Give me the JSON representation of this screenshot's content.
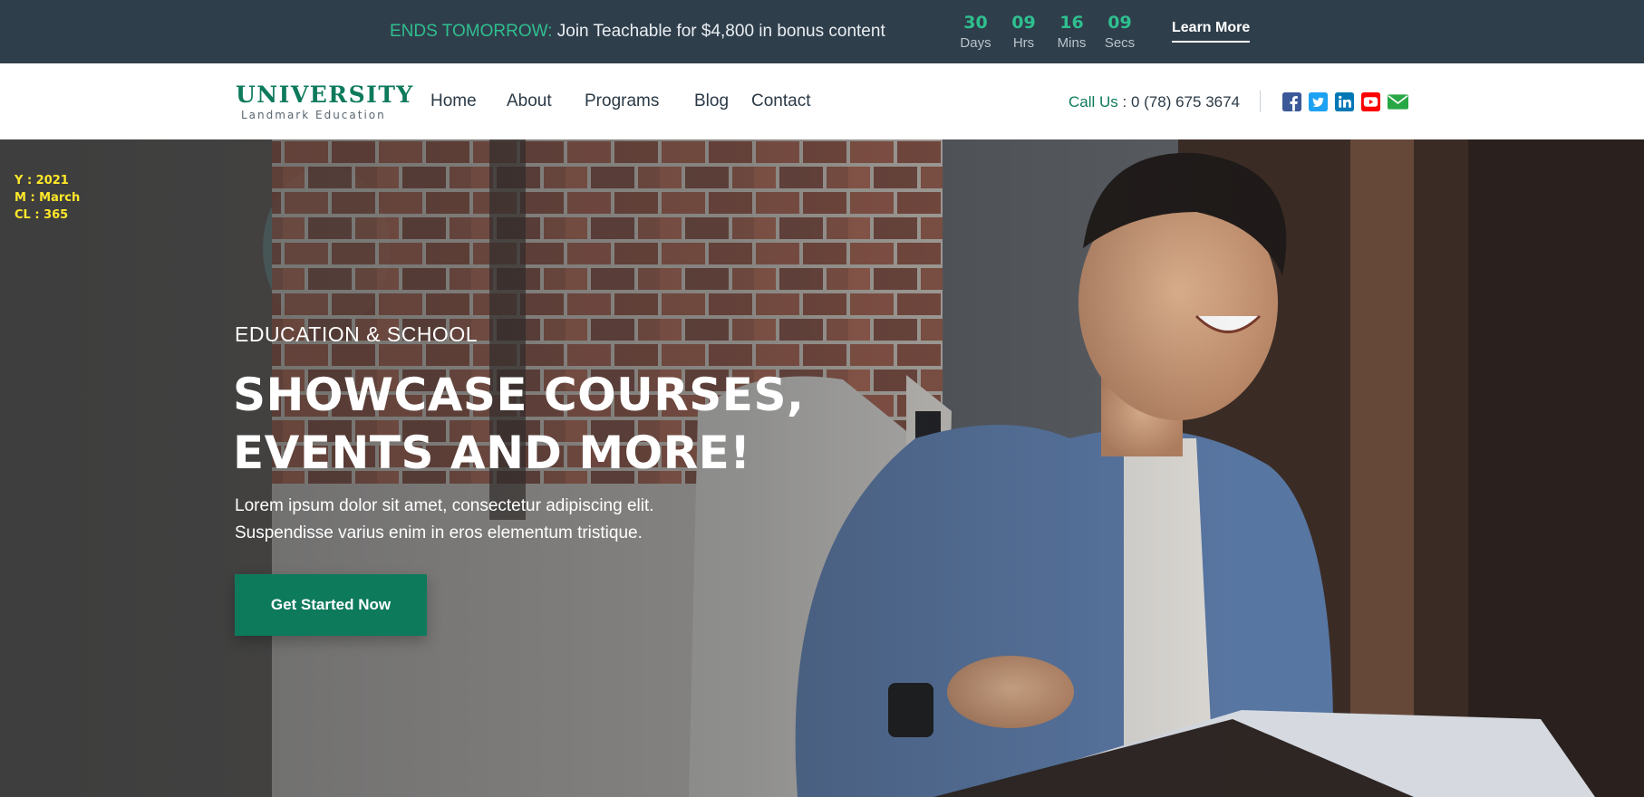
{
  "announcement": {
    "highlight": "ENDS TOMORROW:",
    "message": " Join Teachable for $4,800 in bonus content",
    "countdown": [
      {
        "value": "30",
        "label": "Days"
      },
      {
        "value": "09",
        "label": "Hrs"
      },
      {
        "value": "16",
        "label": "Mins"
      },
      {
        "value": "09",
        "label": "Secs"
      }
    ],
    "cta_label": "Learn More"
  },
  "brand": {
    "title": "UNIVERSITY",
    "subtitle": "Landmark Education",
    "primary_color": "#0e7a5c"
  },
  "nav": {
    "items": [
      {
        "label": "Home"
      },
      {
        "label": "About"
      },
      {
        "label": "Programs"
      },
      {
        "label": "Blog"
      },
      {
        "label": "Contact"
      }
    ]
  },
  "contact": {
    "call_label": "Call Us",
    "separator": " : ",
    "phone": "0 (78) 675 3674"
  },
  "socials": [
    {
      "icon": "facebook-icon",
      "color": "#3b5998"
    },
    {
      "icon": "twitter-icon",
      "color": "#1da1f2"
    },
    {
      "icon": "linkedin-icon",
      "color": "#0077b5"
    },
    {
      "icon": "youtube-icon",
      "color": "#ff0000"
    },
    {
      "icon": "envelope-icon",
      "color": "#28a745"
    }
  ],
  "stats": {
    "year": "Y : 2021",
    "month": "M : March",
    "cl": "CL : 365"
  },
  "hero": {
    "eyebrow": "EDUCATION & SCHOOL",
    "headline_line1": "SHOWCASE COURSES,",
    "headline_line2": "EVENTS AND MORE!",
    "lead_line1": "Lorem ipsum dolor sit amet, consectetur adipiscing elit.",
    "lead_line2": "Suspendisse varius enim in eros elementum tristique.",
    "cta_label": "Get Started Now"
  }
}
